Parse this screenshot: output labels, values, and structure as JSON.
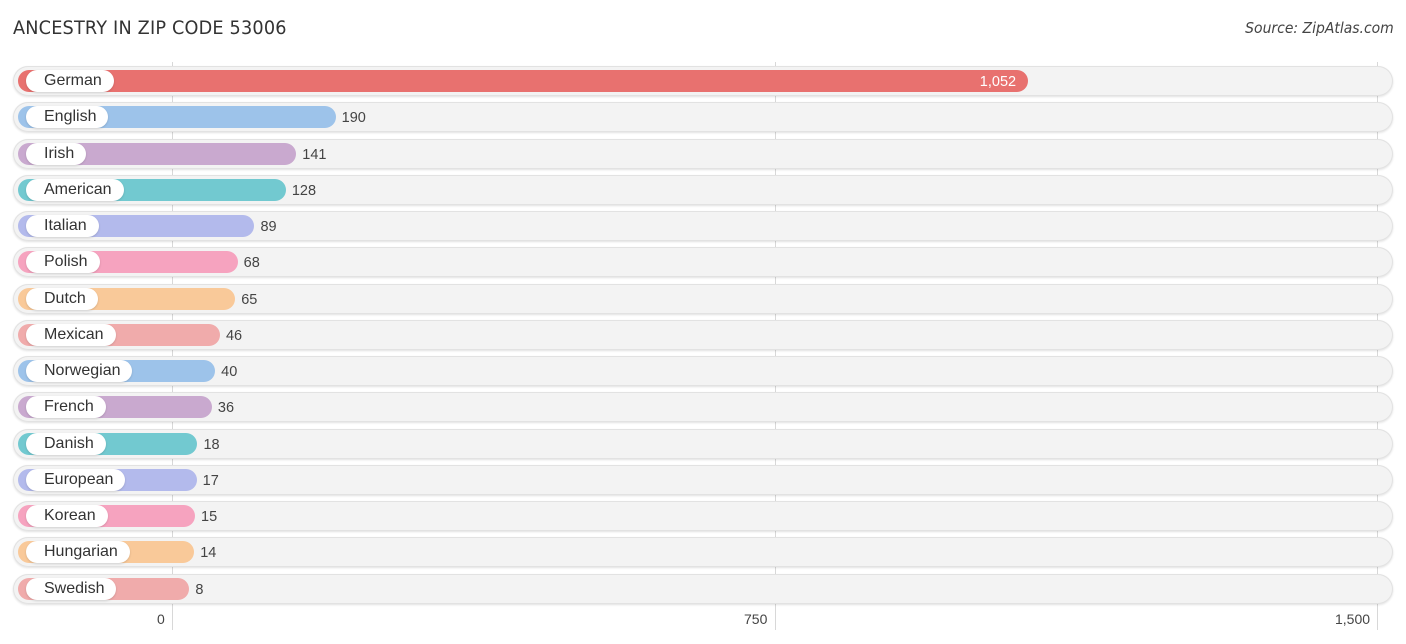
{
  "header": {
    "title": "ANCESTRY IN ZIP CODE 53006",
    "source": "Source: ZipAtlas.com"
  },
  "chart_data": {
    "type": "bar",
    "orientation": "horizontal",
    "title": "ANCESTRY IN ZIP CODE 53006",
    "source": "Source: ZipAtlas.com",
    "xlabel": "",
    "ylabel": "",
    "xlim": [
      0,
      1500
    ],
    "ticks": [
      {
        "value": 0,
        "label": "0"
      },
      {
        "value": 750,
        "label": "750"
      },
      {
        "value": 1500,
        "label": "1,500"
      }
    ],
    "grid": true,
    "categories": [
      "German",
      "English",
      "Irish",
      "American",
      "Italian",
      "Polish",
      "Dutch",
      "Mexican",
      "Norwegian",
      "French",
      "Danish",
      "European",
      "Korean",
      "Hungarian",
      "Swedish"
    ],
    "values": [
      1052,
      190,
      141,
      128,
      89,
      68,
      65,
      46,
      40,
      36,
      18,
      17,
      15,
      14,
      8
    ],
    "value_labels": [
      "1,052",
      "190",
      "141",
      "128",
      "89",
      "68",
      "65",
      "46",
      "40",
      "36",
      "18",
      "17",
      "15",
      "14",
      "8"
    ],
    "colors": [
      "#e8716f",
      "#9dc3ea",
      "#c9a9cf",
      "#72c9d0",
      "#b3baec",
      "#f6a3bf",
      "#f9c999",
      "#f0abab",
      "#9dc3ea",
      "#c9a9cf",
      "#72c9d0",
      "#b3baec",
      "#f6a3bf",
      "#f9c999",
      "#f0abab"
    ]
  }
}
